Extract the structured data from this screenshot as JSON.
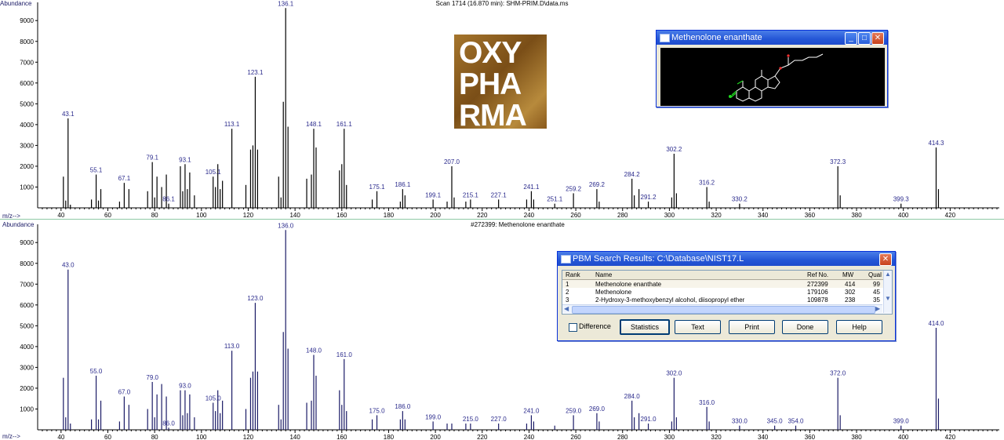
{
  "chart_data": [
    {
      "type": "bar",
      "title": "Scan 1714 (16.870 min): SHM-PRIM.D\\data.ms",
      "ylabel": "Abundance",
      "xlabel": "m/z-->",
      "xlim": [
        30,
        441
      ],
      "ylim": [
        0,
        9800
      ],
      "xticks": [
        40,
        60,
        80,
        100,
        120,
        140,
        160,
        180,
        200,
        220,
        240,
        260,
        280,
        300,
        320,
        340,
        360,
        380,
        400,
        420
      ],
      "yticks": [
        1000,
        2000,
        3000,
        4000,
        5000,
        6000,
        7000,
        8000,
        9000
      ],
      "bar_color": "#000000",
      "label_color": "#2a2a8c",
      "series": [
        {
          "values": [
            [
              41,
              1500
            ],
            [
              42,
              350
            ],
            [
              43,
              4300
            ],
            [
              44,
              150
            ],
            [
              53,
              400
            ],
            [
              55,
              1600
            ],
            [
              56,
              350
            ],
            [
              57,
              900
            ],
            [
              65,
              300
            ],
            [
              67,
              1200
            ],
            [
              69,
              900
            ],
            [
              77,
              800
            ],
            [
              79,
              2200
            ],
            [
              80,
              500
            ],
            [
              81,
              1500
            ],
            [
              83,
              1000
            ],
            [
              85,
              1600
            ],
            [
              86,
              200
            ],
            [
              91,
              2000
            ],
            [
              92,
              800
            ],
            [
              93,
              2100
            ],
            [
              94,
              900
            ],
            [
              95,
              1700
            ],
            [
              97,
              600
            ],
            [
              105,
              1500
            ],
            [
              106,
              1000
            ],
            [
              107,
              2100
            ],
            [
              108,
              900
            ],
            [
              109,
              1300
            ],
            [
              113,
              3800
            ],
            [
              119,
              1100
            ],
            [
              121,
              2800
            ],
            [
              122,
              3000
            ],
            [
              123,
              6300
            ],
            [
              124,
              2800
            ],
            [
              133,
              1500
            ],
            [
              134,
              500
            ],
            [
              135,
              5100
            ],
            [
              136,
              9600
            ],
            [
              137,
              3900
            ],
            [
              145,
              1400
            ],
            [
              147,
              1600
            ],
            [
              148,
              3800
            ],
            [
              149,
              2900
            ],
            [
              159,
              1800
            ],
            [
              160,
              2100
            ],
            [
              161,
              3800
            ],
            [
              162,
              1100
            ],
            [
              173,
              400
            ],
            [
              175,
              800
            ],
            [
              185,
              300
            ],
            [
              186,
              900
            ],
            [
              187,
              600
            ],
            [
              199,
              400
            ],
            [
              205,
              300
            ],
            [
              207,
              2000
            ],
            [
              208,
              500
            ],
            [
              213,
              300
            ],
            [
              215,
              400
            ],
            [
              227,
              400
            ],
            [
              239,
              400
            ],
            [
              241,
              800
            ],
            [
              242,
              400
            ],
            [
              251,
              200
            ],
            [
              259,
              700
            ],
            [
              269,
              900
            ],
            [
              270,
              300
            ],
            [
              284,
              1400
            ],
            [
              285,
              600
            ],
            [
              287,
              900
            ],
            [
              291,
              300
            ],
            [
              301,
              500
            ],
            [
              302,
              2600
            ],
            [
              303,
              700
            ],
            [
              316,
              1000
            ],
            [
              317,
              300
            ],
            [
              330,
              200
            ],
            [
              372,
              2000
            ],
            [
              373,
              600
            ],
            [
              399,
              200
            ],
            [
              414,
              2900
            ],
            [
              415,
              900
            ]
          ]
        }
      ],
      "annotations": [
        {
          "x": 43,
          "y": 4300,
          "text": "43.1"
        },
        {
          "x": 55,
          "y": 1600,
          "text": "55.1"
        },
        {
          "x": 67,
          "y": 1200,
          "text": "67.1"
        },
        {
          "x": 79,
          "y": 2200,
          "text": "79.1"
        },
        {
          "x": 86,
          "y": 200,
          "text": "86.1"
        },
        {
          "x": 93,
          "y": 2100,
          "text": "93.1"
        },
        {
          "x": 105,
          "y": 1500,
          "text": "105.1"
        },
        {
          "x": 113,
          "y": 3800,
          "text": "113.1"
        },
        {
          "x": 123,
          "y": 6300,
          "text": "123.1"
        },
        {
          "x": 136,
          "y": 9600,
          "text": "136.1"
        },
        {
          "x": 148,
          "y": 3800,
          "text": "148.1"
        },
        {
          "x": 161,
          "y": 3800,
          "text": "161.1"
        },
        {
          "x": 175,
          "y": 800,
          "text": "175.1"
        },
        {
          "x": 186,
          "y": 900,
          "text": "186.1"
        },
        {
          "x": 199,
          "y": 400,
          "text": "199.1"
        },
        {
          "x": 207,
          "y": 2000,
          "text": "207.0"
        },
        {
          "x": 215,
          "y": 400,
          "text": "215.1"
        },
        {
          "x": 227,
          "y": 400,
          "text": "227.1"
        },
        {
          "x": 241,
          "y": 800,
          "text": "241.1"
        },
        {
          "x": 251,
          "y": 200,
          "text": "251.1"
        },
        {
          "x": 259,
          "y": 700,
          "text": "259.2"
        },
        {
          "x": 269,
          "y": 900,
          "text": "269.2"
        },
        {
          "x": 284,
          "y": 1400,
          "text": "284.2"
        },
        {
          "x": 291,
          "y": 300,
          "text": "291.2"
        },
        {
          "x": 302,
          "y": 2600,
          "text": "302.2"
        },
        {
          "x": 316,
          "y": 1000,
          "text": "316.2"
        },
        {
          "x": 330,
          "y": 200,
          "text": "330.2"
        },
        {
          "x": 372,
          "y": 2000,
          "text": "372.3"
        },
        {
          "x": 399,
          "y": 200,
          "text": "399.3"
        },
        {
          "x": 414,
          "y": 2900,
          "text": "414.3"
        }
      ],
      "grid": false,
      "legend": "none"
    },
    {
      "type": "bar",
      "title": "#272399: Methenolone enanthate",
      "ylabel": "Abundance",
      "xlabel": "m/z-->",
      "xlim": [
        30,
        441
      ],
      "ylim": [
        0,
        9800
      ],
      "xticks": [
        40,
        60,
        80,
        100,
        120,
        140,
        160,
        180,
        200,
        220,
        240,
        260,
        280,
        300,
        320,
        340,
        360,
        380,
        400,
        420
      ],
      "yticks": [
        1000,
        2000,
        3000,
        4000,
        5000,
        6000,
        7000,
        8000,
        9000
      ],
      "bar_color": "#1a1a66",
      "label_color": "#2a2a8c",
      "series": [
        {
          "values": [
            [
              41,
              2500
            ],
            [
              42,
              600
            ],
            [
              43,
              7700
            ],
            [
              44,
              300
            ],
            [
              53,
              500
            ],
            [
              55,
              2600
            ],
            [
              56,
              500
            ],
            [
              57,
              1400
            ],
            [
              65,
              400
            ],
            [
              67,
              1600
            ],
            [
              69,
              1200
            ],
            [
              77,
              1000
            ],
            [
              79,
              2300
            ],
            [
              80,
              600
            ],
            [
              81,
              1700
            ],
            [
              83,
              2200
            ],
            [
              85,
              1600
            ],
            [
              86,
              100
            ],
            [
              91,
              1900
            ],
            [
              92,
              700
            ],
            [
              93,
              1900
            ],
            [
              94,
              800
            ],
            [
              95,
              1700
            ],
            [
              97,
              600
            ],
            [
              105,
              1300
            ],
            [
              106,
              900
            ],
            [
              107,
              1900
            ],
            [
              108,
              800
            ],
            [
              109,
              1400
            ],
            [
              113,
              3800
            ],
            [
              119,
              1000
            ],
            [
              121,
              2500
            ],
            [
              122,
              2800
            ],
            [
              123,
              6100
            ],
            [
              124,
              2800
            ],
            [
              133,
              1200
            ],
            [
              134,
              500
            ],
            [
              135,
              4700
            ],
            [
              136,
              9600
            ],
            [
              137,
              3900
            ],
            [
              145,
              1300
            ],
            [
              147,
              1400
            ],
            [
              148,
              3600
            ],
            [
              149,
              2600
            ],
            [
              159,
              1900
            ],
            [
              160,
              1200
            ],
            [
              161,
              3400
            ],
            [
              162,
              900
            ],
            [
              173,
              500
            ],
            [
              175,
              700
            ],
            [
              185,
              500
            ],
            [
              186,
              900
            ],
            [
              187,
              500
            ],
            [
              199,
              400
            ],
            [
              205,
              300
            ],
            [
              207,
              300
            ],
            [
              213,
              300
            ],
            [
              215,
              300
            ],
            [
              227,
              300
            ],
            [
              239,
              300
            ],
            [
              241,
              700
            ],
            [
              242,
              400
            ],
            [
              251,
              200
            ],
            [
              259,
              700
            ],
            [
              269,
              800
            ],
            [
              270,
              400
            ],
            [
              284,
              1400
            ],
            [
              285,
              600
            ],
            [
              287,
              800
            ],
            [
              291,
              300
            ],
            [
              301,
              400
            ],
            [
              302,
              2500
            ],
            [
              303,
              600
            ],
            [
              316,
              1100
            ],
            [
              317,
              400
            ],
            [
              330,
              200
            ],
            [
              345,
              200
            ],
            [
              354,
              200
            ],
            [
              372,
              2500
            ],
            [
              373,
              700
            ],
            [
              399,
              200
            ],
            [
              414,
              4900
            ],
            [
              415,
              1500
            ]
          ]
        }
      ],
      "annotations": [
        {
          "x": 43,
          "y": 7700,
          "text": "43.0"
        },
        {
          "x": 55,
          "y": 2600,
          "text": "55.0"
        },
        {
          "x": 67,
          "y": 1600,
          "text": "67.0"
        },
        {
          "x": 79,
          "y": 2300,
          "text": "79.0"
        },
        {
          "x": 86,
          "y": 100,
          "text": "86.0"
        },
        {
          "x": 93,
          "y": 1900,
          "text": "93.0"
        },
        {
          "x": 105,
          "y": 1300,
          "text": "105.0"
        },
        {
          "x": 113,
          "y": 3800,
          "text": "113.0"
        },
        {
          "x": 123,
          "y": 6100,
          "text": "123.0"
        },
        {
          "x": 136,
          "y": 9600,
          "text": "136.0"
        },
        {
          "x": 148,
          "y": 3600,
          "text": "148.0"
        },
        {
          "x": 161,
          "y": 3400,
          "text": "161.0"
        },
        {
          "x": 175,
          "y": 700,
          "text": "175.0"
        },
        {
          "x": 186,
          "y": 900,
          "text": "186.0"
        },
        {
          "x": 199,
          "y": 400,
          "text": "199.0"
        },
        {
          "x": 215,
          "y": 300,
          "text": "215.0"
        },
        {
          "x": 227,
          "y": 300,
          "text": "227.0"
        },
        {
          "x": 241,
          "y": 700,
          "text": "241.0"
        },
        {
          "x": 259,
          "y": 700,
          "text": "259.0"
        },
        {
          "x": 269,
          "y": 800,
          "text": "269.0"
        },
        {
          "x": 284,
          "y": 1400,
          "text": "284.0"
        },
        {
          "x": 291,
          "y": 300,
          "text": "291.0"
        },
        {
          "x": 302,
          "y": 2500,
          "text": "302.0"
        },
        {
          "x": 316,
          "y": 1100,
          "text": "316.0"
        },
        {
          "x": 330,
          "y": 200,
          "text": "330.0"
        },
        {
          "x": 345,
          "y": 200,
          "text": "345.0"
        },
        {
          "x": 354,
          "y": 200,
          "text": "354.0"
        },
        {
          "x": 372,
          "y": 2500,
          "text": "372.0"
        },
        {
          "x": 399,
          "y": 200,
          "text": "399.0"
        },
        {
          "x": 414,
          "y": 4900,
          "text": "414.0"
        }
      ],
      "grid": false,
      "legend": "none"
    }
  ],
  "logo": {
    "lines": [
      "OXY",
      "PHA",
      "RMA"
    ]
  },
  "structure_window": {
    "title": "Methenolone enanthate",
    "molecule_color": "#1fd81f"
  },
  "pbm": {
    "title": "PBM Search Results: C:\\Database\\NIST17.L",
    "columns": {
      "rank": "Rank",
      "name": "Name",
      "ref": "Ref No.",
      "mw": "MW",
      "qual": "Qual"
    },
    "rows": [
      {
        "rank": "1",
        "name": "Methenolone enanthate",
        "ref": "272399",
        "mw": "414",
        "qual": "99"
      },
      {
        "rank": "2",
        "name": "Methenolone",
        "ref": "179106",
        "mw": "302",
        "qual": "45"
      },
      {
        "rank": "3",
        "name": "2-Hydroxy-3-methoxybenzyl alcohol, diisopropyl ether",
        "ref": "109878",
        "mw": "238",
        "qual": "35"
      }
    ],
    "difference_label": "Difference",
    "difference_checked": false,
    "buttons": {
      "statistics": "Statistics",
      "text": "Text",
      "print": "Print",
      "done": "Done",
      "help": "Help"
    }
  }
}
